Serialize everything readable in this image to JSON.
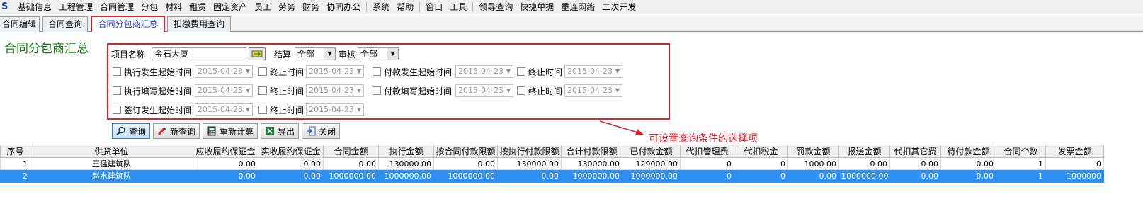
{
  "menu": [
    "基础信息",
    "工程管理",
    "合同管理",
    "分包",
    "材料",
    "租赁",
    "固定资产",
    "员工",
    "劳务",
    "财务",
    "协同办公",
    "系统",
    "帮助",
    "窗口",
    "工具",
    "领导查询",
    "快捷单据",
    "重连网络",
    "二次开发"
  ],
  "tabs": [
    "合同编辑",
    "合同查询",
    "合同分包商汇总",
    "扣缴费用查询"
  ],
  "title": "合同分包商汇总",
  "query": {
    "project_label": "项目名称",
    "project_value": "金石大厦",
    "settle_label": "结算",
    "settle_value": "全部",
    "audit_label": "审核",
    "audit_value": "全部",
    "exec_start_label": "执行发生起始时间",
    "exec_start_value": "2015-04-23",
    "end1_label": "终止时间",
    "end1_value": "2015-04-23",
    "pay_start_label": "付款发生起始时间",
    "pay_start_value": "2015-04-23",
    "end2_label": "终止时间",
    "end2_value": "2015-04-23",
    "fill_start_label": "执行填写起始时间",
    "fill_start_value": "2015-04-23",
    "end3_label": "终止时间",
    "end3_value": "2015-04-23",
    "payfill_start_label": "付款填写起始时间",
    "payfill_start_value": "2015-04-23",
    "end4_label": "终止时间",
    "end4_value": "2015-04-23",
    "sign_start_label": "签订发生起始时间",
    "sign_start_value": "2015-04-23",
    "end5_label": "终止时间",
    "end5_value": "2015-04-23"
  },
  "toolbar": [
    "查询",
    "新查询",
    "重新计算",
    "导出",
    "关闭"
  ],
  "annotation": "可设置查询条件的选择项",
  "table": {
    "headers": [
      "序号",
      "供货单位",
      "应收履约保证金",
      "实收履约保证金",
      "合同金额",
      "执行金额",
      "按合同付款限额",
      "按执行付款限额",
      "合计付款限额",
      "已付款金额",
      "代扣管理费",
      "代扣税金",
      "罚款金额",
      "报送金额",
      "代扣其它费",
      "待付款金额",
      "合同个数",
      "发票金额"
    ],
    "rows": [
      [
        "1",
        "王猛建筑队",
        "0.00",
        "0.00",
        "0.00",
        "130000.00",
        "0.00",
        "130000.00",
        "130000.00",
        "129000.00",
        "0",
        "0",
        "1000.00",
        "0.00",
        "0.00",
        "0.00",
        "1",
        "0"
      ],
      [
        "2",
        "赵水建筑队",
        "0.00",
        "0.00",
        "1000000.00",
        "1000000.00",
        "1000000.00",
        "0.00",
        "1000000.00",
        "1000000.00",
        "0",
        "0",
        "0.00",
        "1000000.00",
        "0.00",
        "0.00",
        "1",
        "1000000"
      ]
    ]
  },
  "colors": {
    "accent_red": "#e0202a",
    "title_green": "#127a12",
    "selection_blue": "#2f8ff0"
  }
}
